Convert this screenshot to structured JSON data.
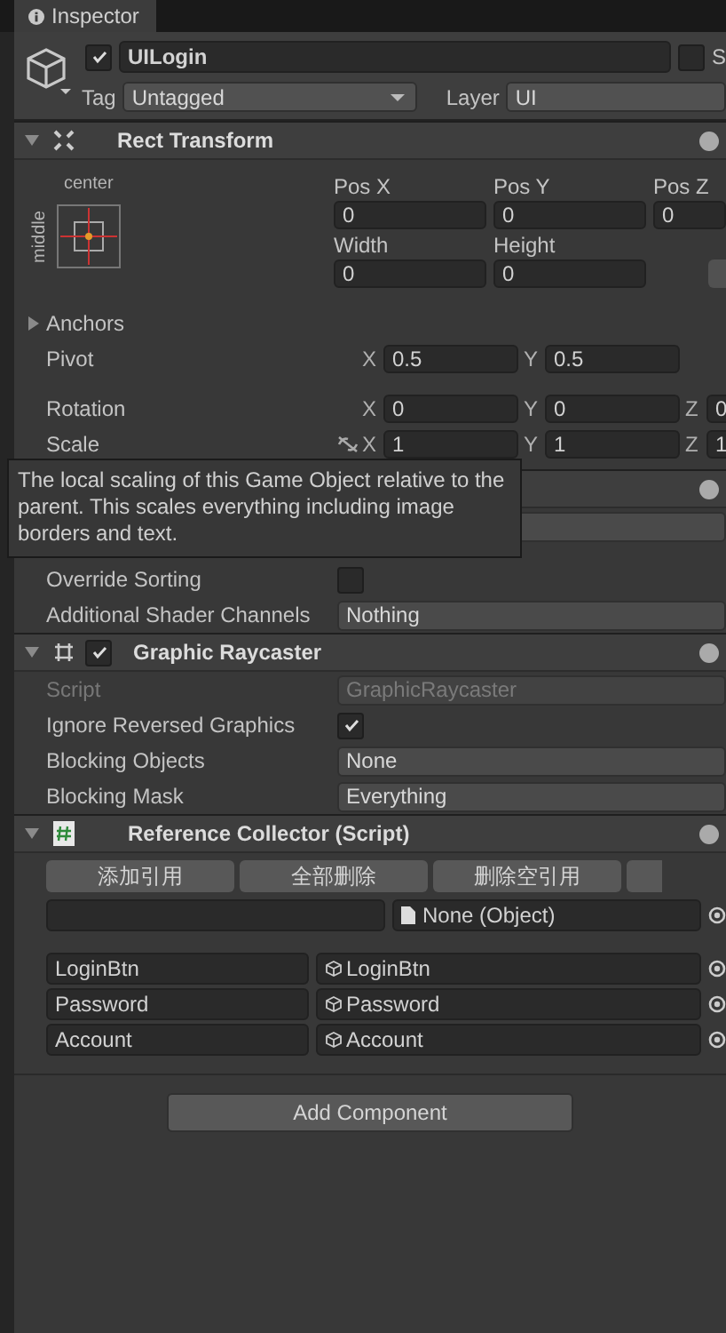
{
  "tab": {
    "label": "Inspector"
  },
  "object": {
    "active": true,
    "name": "UILogin",
    "static_label": "S",
    "static": false,
    "tag_label": "Tag",
    "tag": "Untagged",
    "layer_label": "Layer",
    "layer": "UI"
  },
  "rect_transform": {
    "title": "Rect Transform",
    "anchor_h": "center",
    "anchor_v": "middle",
    "pos_fields": [
      {
        "label": "Pos X",
        "value": "0"
      },
      {
        "label": "Pos Y",
        "value": "0"
      },
      {
        "label": "Pos Z",
        "value": "0"
      }
    ],
    "size_fields": [
      {
        "label": "Width",
        "value": "0"
      },
      {
        "label": "Height",
        "value": "0"
      }
    ],
    "anchors": "Anchors",
    "rows": [
      {
        "label": "Pivot",
        "link": false,
        "axes": [
          {
            "axis": "X",
            "value": "0.5"
          },
          {
            "axis": "Y",
            "value": "0.5"
          }
        ]
      },
      {
        "label": "Rotation",
        "link": false,
        "axes": [
          {
            "axis": "X",
            "value": "0"
          },
          {
            "axis": "Y",
            "value": "0"
          },
          {
            "axis": "Z",
            "value": "0"
          }
        ]
      },
      {
        "label": "Scale",
        "link": true,
        "axes": [
          {
            "axis": "X",
            "value": "1"
          },
          {
            "axis": "Y",
            "value": "1"
          },
          {
            "axis": "Z",
            "value": "1"
          }
        ]
      }
    ]
  },
  "tooltip": "The local scaling of this Game Object relative to the parent. This scales everything including image borders and text.",
  "canvas": {
    "rows": [
      {
        "label": "Override Sorting",
        "kind": "checkbox",
        "checked": false
      },
      {
        "label": "Additional Shader Channels",
        "kind": "dropdown",
        "value": "Nothing"
      }
    ]
  },
  "graphic_raycaster": {
    "title": "Graphic Raycaster",
    "enabled": true,
    "rows": [
      {
        "label": "Script",
        "kind": "script",
        "value": "GraphicRaycaster"
      },
      {
        "label": "Ignore Reversed Graphics",
        "kind": "checkbox",
        "checked": true
      },
      {
        "label": "Blocking Objects",
        "kind": "dropdown",
        "value": "None"
      },
      {
        "label": "Blocking Mask",
        "kind": "dropdown",
        "value": "Everything"
      }
    ]
  },
  "reference_collector": {
    "title": "Reference Collector (Script)",
    "buttons": [
      "添加引用",
      "全部删除",
      "删除空引用"
    ],
    "new_object": "None (Object)",
    "entries": [
      {
        "key": "LoginBtn",
        "object": "LoginBtn"
      },
      {
        "key": "Password",
        "object": "Password"
      },
      {
        "key": "Account",
        "object": "Account"
      }
    ]
  },
  "add_component": "Add Component"
}
